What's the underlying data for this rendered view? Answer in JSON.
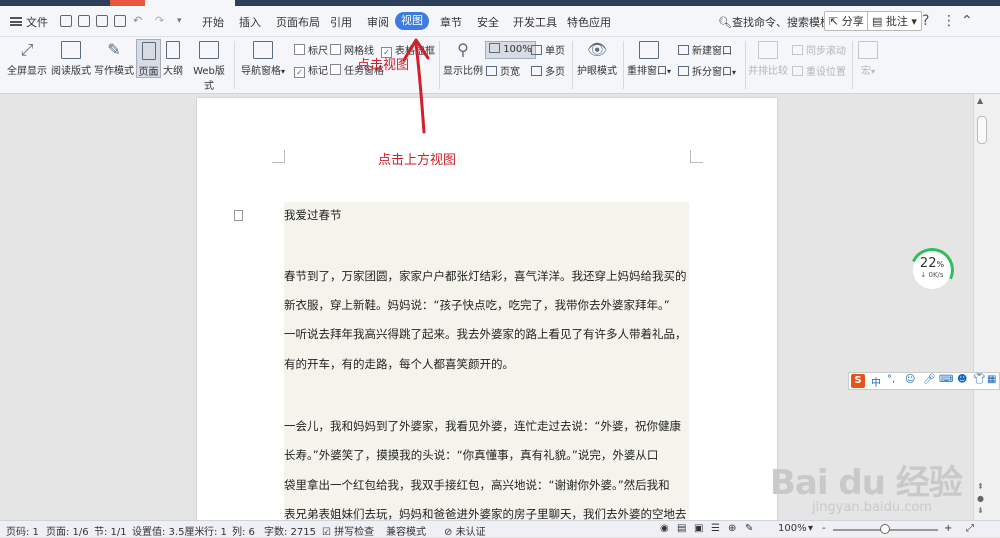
{
  "menubar": {
    "file": "文件",
    "tabs": [
      "开始",
      "插入",
      "页面布局",
      "引用",
      "审阅",
      "视图",
      "章节",
      "安全",
      "开发工具",
      "特色应用"
    ],
    "active_tab": "视图",
    "search": "查找命令、搜索模板",
    "share": "分享",
    "comment": "批注",
    "help": "?",
    "accent": "#3d7be0"
  },
  "ribbon": {
    "fullscreen": "全屏显示",
    "reading": "阅读版式",
    "writing": "写作模式",
    "page": "页面",
    "outline": "大纲",
    "web": "Web版式",
    "nav_pane": "导航窗格",
    "ruler": "标尺",
    "grid": "网格线",
    "table_tip": "表格虚框",
    "mark": "标记",
    "task_pane": "任务窗格",
    "zoom_ratio": "显示比例",
    "zoom_value": "100%",
    "page_width": "页宽",
    "single_page": "单页",
    "multi_page": "多页",
    "eye_mode": "护眼模式",
    "rearrange": "重排窗口",
    "new_window": "新建窗口",
    "split_window": "拆分窗口",
    "side_by_side": "并排比较",
    "sync_scroll": "同步滚动",
    "reset_pos": "重设位置",
    "macro": "宏"
  },
  "document": {
    "top_annotation": "点击视图",
    "annotation": "点击上方视图",
    "title": "我爱过春节",
    "paragraphs": [
      "春节到了，万家团圆，家家户户都张灯结彩，喜气洋洋。我还穿上妈妈给我买的",
      "新衣服，穿上新鞋。妈妈说：“孩子快点吃，吃完了，我带你去外婆家拜年。”",
      "一听说去拜年我高兴得跳了起来。我去外婆家的路上看见了有许多人带着礼品，",
      "有的开车，有的走路，每个人都喜笑颜开的。",
      "一会儿，我和妈妈到了外婆家，我看见外婆，连忙走过去说：“外婆，祝你健康",
      "长寿。”外婆笑了，摸摸我的头说：“你真懂事，真有礼貌。”说完，外婆从口",
      "袋里拿出一个红包给我，我双手接红包，高兴地说：“谢谢你外婆。”然后我和",
      "表兄弟表姐妹们去玩，妈妈和爸爸进外婆家的房子里聊天，我们去外婆的空地去"
    ],
    "annotation_color": "#d1202a"
  },
  "speed_widget": {
    "percent": "22",
    "percent_sign": "%",
    "rate": "0K/s"
  },
  "ime": {
    "logo": "S",
    "lang": "中"
  },
  "watermark": {
    "brand": "Bai du 经验",
    "url": "jingyan.baidu.com"
  },
  "status": {
    "page_code": "页码: 1",
    "pages": "页面: 1/6",
    "section": "节: 1/1",
    "setting": "设置值: 3.5厘米",
    "row": "行: 1",
    "col": "列: 6",
    "words": "字数: 2715",
    "spell": "拼写检查",
    "compat": "兼容模式",
    "cert": "未认证",
    "zoom": "100%",
    "minus": "-",
    "plus": "+"
  }
}
